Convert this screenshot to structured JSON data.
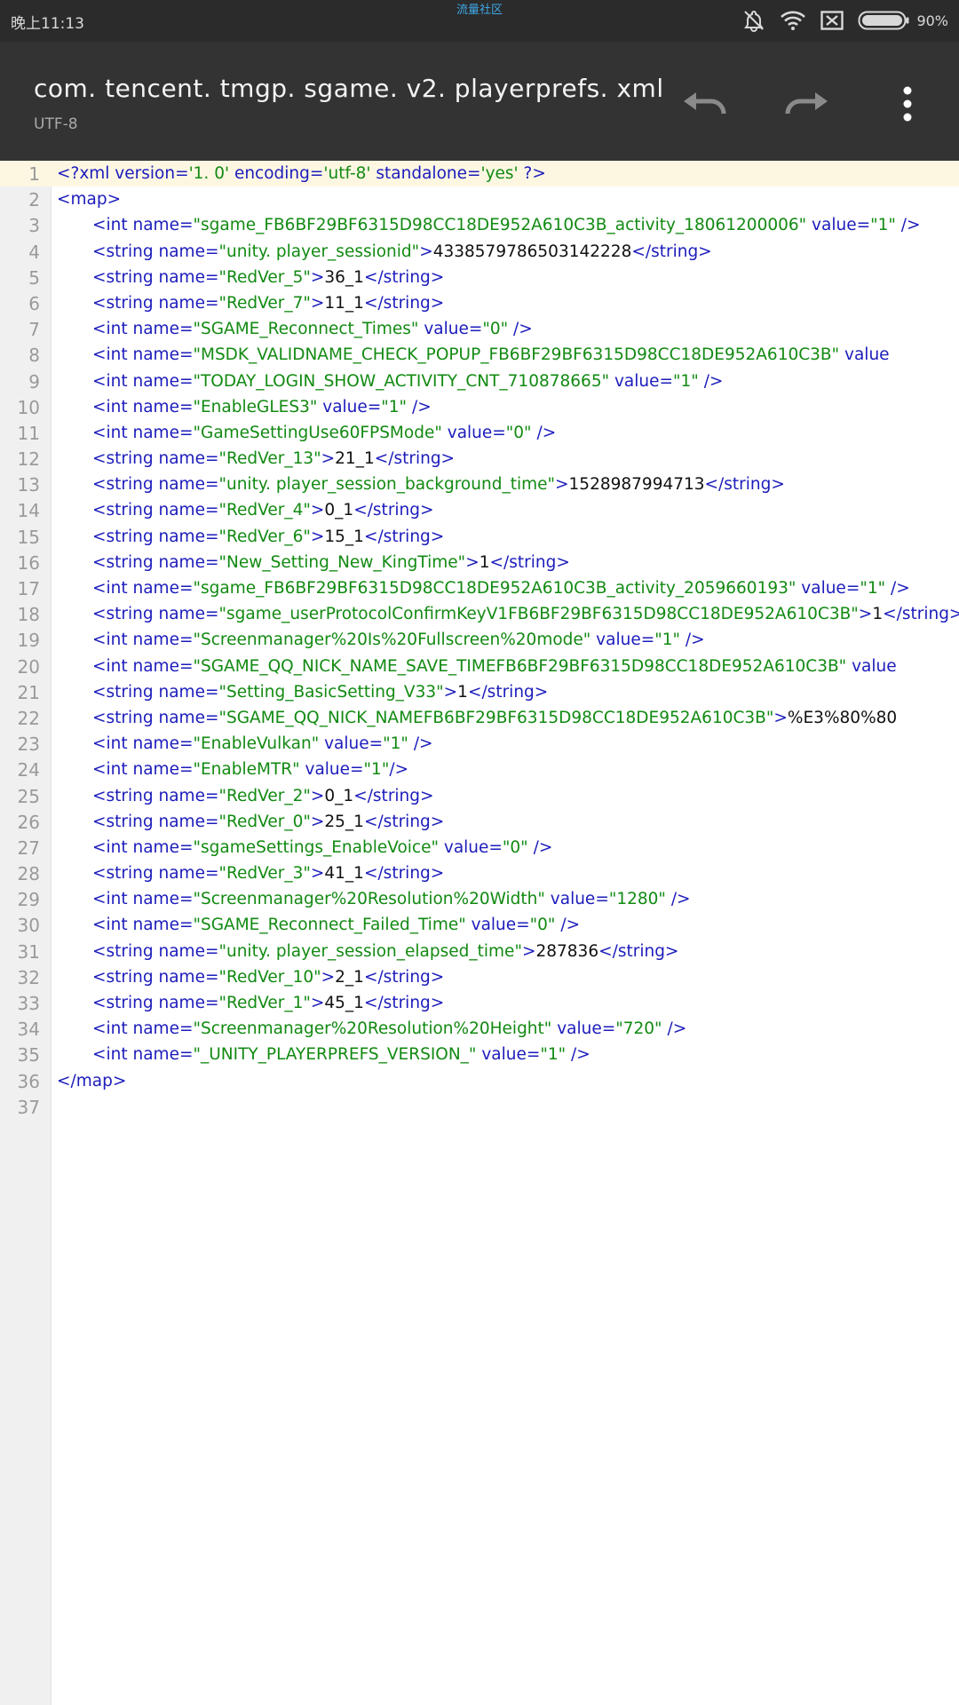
{
  "status_bar": {
    "time": "晚上11:13",
    "center_text": "流量社区",
    "battery": "90%",
    "icons": [
      "bell-off-icon",
      "wifi-icon",
      "no-sim-icon",
      "battery-icon"
    ]
  },
  "toolbar": {
    "file_name": "com. tencent. tmgp. sgame. v2. playerprefs. xml",
    "encoding": "UTF-8",
    "undo_icon": "undo-icon",
    "redo_icon": "redo-icon",
    "more_icon": "more-vert-icon"
  },
  "editor": {
    "current_line": 1,
    "lines": [
      {
        "n": "1",
        "indent": 0,
        "t": [
          [
            "tag",
            "<?xml version="
          ],
          [
            "str",
            "'1. 0'"
          ],
          [
            "tag",
            " encoding="
          ],
          [
            "str",
            "'utf-8'"
          ],
          [
            "tag",
            " standalone="
          ],
          [
            "str",
            "'yes'"
          ],
          [
            "tag",
            " ?>"
          ]
        ]
      },
      {
        "n": "2",
        "indent": 0,
        "t": [
          [
            "tag",
            "<map>"
          ]
        ]
      },
      {
        "n": "3",
        "indent": 1,
        "t": [
          [
            "tag",
            "<int name="
          ],
          [
            "str",
            "\"sgame_FB6BF29BF6315D98CC18DE952A610C3B_activity_18061200006\""
          ],
          [
            "tag",
            " value="
          ],
          [
            "str",
            "\"1\""
          ],
          [
            "tag",
            " />"
          ]
        ]
      },
      {
        "n": "4",
        "indent": 1,
        "t": [
          [
            "tag",
            "<string name="
          ],
          [
            "str",
            "\"unity. player_sessionid\""
          ],
          [
            "tag",
            ">"
          ],
          [
            "txt",
            "4338579786503142228"
          ],
          [
            "tag",
            "</string>"
          ]
        ]
      },
      {
        "n": "5",
        "indent": 1,
        "t": [
          [
            "tag",
            "<string name="
          ],
          [
            "str",
            "\"RedVer_5\""
          ],
          [
            "tag",
            ">"
          ],
          [
            "txt",
            "36_1"
          ],
          [
            "tag",
            "</string>"
          ]
        ]
      },
      {
        "n": "6",
        "indent": 1,
        "t": [
          [
            "tag",
            "<string name="
          ],
          [
            "str",
            "\"RedVer_7\""
          ],
          [
            "tag",
            ">"
          ],
          [
            "txt",
            "11_1"
          ],
          [
            "tag",
            "</string>"
          ]
        ]
      },
      {
        "n": "7",
        "indent": 1,
        "t": [
          [
            "tag",
            "<int name="
          ],
          [
            "str",
            "\"SGAME_Reconnect_Times\""
          ],
          [
            "tag",
            " value="
          ],
          [
            "str",
            "\"0\""
          ],
          [
            "tag",
            " />"
          ]
        ]
      },
      {
        "n": "8",
        "indent": 1,
        "t": [
          [
            "tag",
            "<int name="
          ],
          [
            "str",
            "\"MSDK_VALIDNAME_CHECK_POPUP_FB6BF29BF6315D98CC18DE952A610C3B\""
          ],
          [
            "tag",
            " value"
          ]
        ]
      },
      {
        "n": "9",
        "indent": 1,
        "t": [
          [
            "tag",
            "<int name="
          ],
          [
            "str",
            "\"TODAY_LOGIN_SHOW_ACTIVITY_CNT_710878665\""
          ],
          [
            "tag",
            " value="
          ],
          [
            "str",
            "\"1\""
          ],
          [
            "tag",
            " />"
          ]
        ]
      },
      {
        "n": "10",
        "indent": 1,
        "t": [
          [
            "tag",
            "<int name="
          ],
          [
            "str",
            "\"EnableGLES3\""
          ],
          [
            "tag",
            " value="
          ],
          [
            "str",
            "\"1\""
          ],
          [
            "tag",
            " />"
          ]
        ]
      },
      {
        "n": "11",
        "indent": 1,
        "t": [
          [
            "tag",
            "<int name="
          ],
          [
            "str",
            "\"GameSettingUse60FPSMode\""
          ],
          [
            "tag",
            " value="
          ],
          [
            "str",
            "\"0\""
          ],
          [
            "tag",
            " />"
          ]
        ]
      },
      {
        "n": "12",
        "indent": 1,
        "t": [
          [
            "tag",
            "<string name="
          ],
          [
            "str",
            "\"RedVer_13\""
          ],
          [
            "tag",
            ">"
          ],
          [
            "txt",
            "21_1"
          ],
          [
            "tag",
            "</string>"
          ]
        ]
      },
      {
        "n": "13",
        "indent": 1,
        "t": [
          [
            "tag",
            "<string name="
          ],
          [
            "str",
            "\"unity. player_session_background_time\""
          ],
          [
            "tag",
            ">"
          ],
          [
            "txt",
            "1528987994713"
          ],
          [
            "tag",
            "</string>"
          ]
        ]
      },
      {
        "n": "14",
        "indent": 1,
        "t": [
          [
            "tag",
            "<string name="
          ],
          [
            "str",
            "\"RedVer_4\""
          ],
          [
            "tag",
            ">"
          ],
          [
            "txt",
            "0_1"
          ],
          [
            "tag",
            "</string>"
          ]
        ]
      },
      {
        "n": "15",
        "indent": 1,
        "t": [
          [
            "tag",
            "<string name="
          ],
          [
            "str",
            "\"RedVer_6\""
          ],
          [
            "tag",
            ">"
          ],
          [
            "txt",
            "15_1"
          ],
          [
            "tag",
            "</string>"
          ]
        ]
      },
      {
        "n": "16",
        "indent": 1,
        "t": [
          [
            "tag",
            "<string name="
          ],
          [
            "str",
            "\"New_Setting_New_KingTime\""
          ],
          [
            "tag",
            ">"
          ],
          [
            "txt",
            "1"
          ],
          [
            "tag",
            "</string>"
          ]
        ]
      },
      {
        "n": "17",
        "indent": 1,
        "t": [
          [
            "tag",
            "<int name="
          ],
          [
            "str",
            "\"sgame_FB6BF29BF6315D98CC18DE952A610C3B_activity_2059660193\""
          ],
          [
            "tag",
            " value="
          ],
          [
            "str",
            "\"1\""
          ],
          [
            "tag",
            " />"
          ]
        ]
      },
      {
        "n": "18",
        "indent": 1,
        "t": [
          [
            "tag",
            "<string name="
          ],
          [
            "str",
            "\"sgame_userProtocolConfirmKeyV1FB6BF29BF6315D98CC18DE952A610C3B\""
          ],
          [
            "tag",
            ">"
          ],
          [
            "txt",
            "1"
          ],
          [
            "tag",
            "</string>"
          ]
        ]
      },
      {
        "n": "19",
        "indent": 1,
        "t": [
          [
            "tag",
            "<int name="
          ],
          [
            "str",
            "\"Screenmanager%20Is%20Fullscreen%20mode\""
          ],
          [
            "tag",
            " value="
          ],
          [
            "str",
            "\"1\""
          ],
          [
            "tag",
            " />"
          ]
        ]
      },
      {
        "n": "20",
        "indent": 1,
        "t": [
          [
            "tag",
            "<int name="
          ],
          [
            "str",
            "\"SGAME_QQ_NICK_NAME_SAVE_TIMEFB6BF29BF6315D98CC18DE952A610C3B\""
          ],
          [
            "tag",
            " value"
          ]
        ]
      },
      {
        "n": "21",
        "indent": 1,
        "t": [
          [
            "tag",
            "<string name="
          ],
          [
            "str",
            "\"Setting_BasicSetting_V33\""
          ],
          [
            "tag",
            ">"
          ],
          [
            "txt",
            "1"
          ],
          [
            "tag",
            "</string>"
          ]
        ]
      },
      {
        "n": "22",
        "indent": 1,
        "t": [
          [
            "tag",
            "<string name="
          ],
          [
            "str",
            "\"SGAME_QQ_NICK_NAMEFB6BF29BF6315D98CC18DE952A610C3B\""
          ],
          [
            "tag",
            ">"
          ],
          [
            "txt",
            "%E3%80%80"
          ]
        ]
      },
      {
        "n": "23",
        "indent": 1,
        "t": [
          [
            "tag",
            "<int name="
          ],
          [
            "str",
            "\"EnableVulkan\""
          ],
          [
            "tag",
            " value="
          ],
          [
            "str",
            "\"1\""
          ],
          [
            "tag",
            " />"
          ]
        ]
      },
      {
        "n": "24",
        "indent": 1,
        "t": [
          [
            "tag",
            "<int name="
          ],
          [
            "str",
            "\"EnableMTR\""
          ],
          [
            "tag",
            " value="
          ],
          [
            "str",
            "\"1\""
          ],
          [
            "tag",
            "/>"
          ]
        ]
      },
      {
        "n": "25",
        "indent": 1,
        "t": [
          [
            "tag",
            "<string name="
          ],
          [
            "str",
            "\"RedVer_2\""
          ],
          [
            "tag",
            ">"
          ],
          [
            "txt",
            "0_1"
          ],
          [
            "tag",
            "</string>"
          ]
        ]
      },
      {
        "n": "26",
        "indent": 1,
        "t": [
          [
            "tag",
            "<string name="
          ],
          [
            "str",
            "\"RedVer_0\""
          ],
          [
            "tag",
            ">"
          ],
          [
            "txt",
            "25_1"
          ],
          [
            "tag",
            "</string>"
          ]
        ]
      },
      {
        "n": "27",
        "indent": 1,
        "t": [
          [
            "tag",
            "<int name="
          ],
          [
            "str",
            "\"sgameSettings_EnableVoice\""
          ],
          [
            "tag",
            " value="
          ],
          [
            "str",
            "\"0\""
          ],
          [
            "tag",
            " />"
          ]
        ]
      },
      {
        "n": "28",
        "indent": 1,
        "t": [
          [
            "tag",
            "<string name="
          ],
          [
            "str",
            "\"RedVer_3\""
          ],
          [
            "tag",
            ">"
          ],
          [
            "txt",
            "41_1"
          ],
          [
            "tag",
            "</string>"
          ]
        ]
      },
      {
        "n": "29",
        "indent": 1,
        "t": [
          [
            "tag",
            "<int name="
          ],
          [
            "str",
            "\"Screenmanager%20Resolution%20Width\""
          ],
          [
            "tag",
            " value="
          ],
          [
            "str",
            "\"1280\""
          ],
          [
            "tag",
            " />"
          ]
        ]
      },
      {
        "n": "30",
        "indent": 1,
        "t": [
          [
            "tag",
            "<int name="
          ],
          [
            "str",
            "\"SGAME_Reconnect_Failed_Time\""
          ],
          [
            "tag",
            " value="
          ],
          [
            "str",
            "\"0\""
          ],
          [
            "tag",
            " />"
          ]
        ]
      },
      {
        "n": "31",
        "indent": 1,
        "t": [
          [
            "tag",
            "<string name="
          ],
          [
            "str",
            "\"unity. player_session_elapsed_time\""
          ],
          [
            "tag",
            ">"
          ],
          [
            "txt",
            "287836"
          ],
          [
            "tag",
            "</string>"
          ]
        ]
      },
      {
        "n": "32",
        "indent": 1,
        "t": [
          [
            "tag",
            "<string name="
          ],
          [
            "str",
            "\"RedVer_10\""
          ],
          [
            "tag",
            ">"
          ],
          [
            "txt",
            "2_1"
          ],
          [
            "tag",
            "</string>"
          ]
        ]
      },
      {
        "n": "33",
        "indent": 1,
        "t": [
          [
            "tag",
            "<string name="
          ],
          [
            "str",
            "\"RedVer_1\""
          ],
          [
            "tag",
            ">"
          ],
          [
            "txt",
            "45_1"
          ],
          [
            "tag",
            "</string>"
          ]
        ]
      },
      {
        "n": "34",
        "indent": 1,
        "t": [
          [
            "tag",
            "<int name="
          ],
          [
            "str",
            "\"Screenmanager%20Resolution%20Height\""
          ],
          [
            "tag",
            " value="
          ],
          [
            "str",
            "\"720\""
          ],
          [
            "tag",
            " />"
          ]
        ]
      },
      {
        "n": "35",
        "indent": 1,
        "t": [
          [
            "tag",
            "<int name="
          ],
          [
            "str",
            "\"_UNITY_PLAYERPREFS_VERSION_\""
          ],
          [
            "tag",
            " value="
          ],
          [
            "str",
            "\"1\""
          ],
          [
            "tag",
            " />"
          ]
        ]
      },
      {
        "n": "36",
        "indent": 0,
        "t": [
          [
            "tag",
            "</map>"
          ]
        ]
      },
      {
        "n": "37",
        "indent": 0,
        "t": []
      }
    ]
  }
}
